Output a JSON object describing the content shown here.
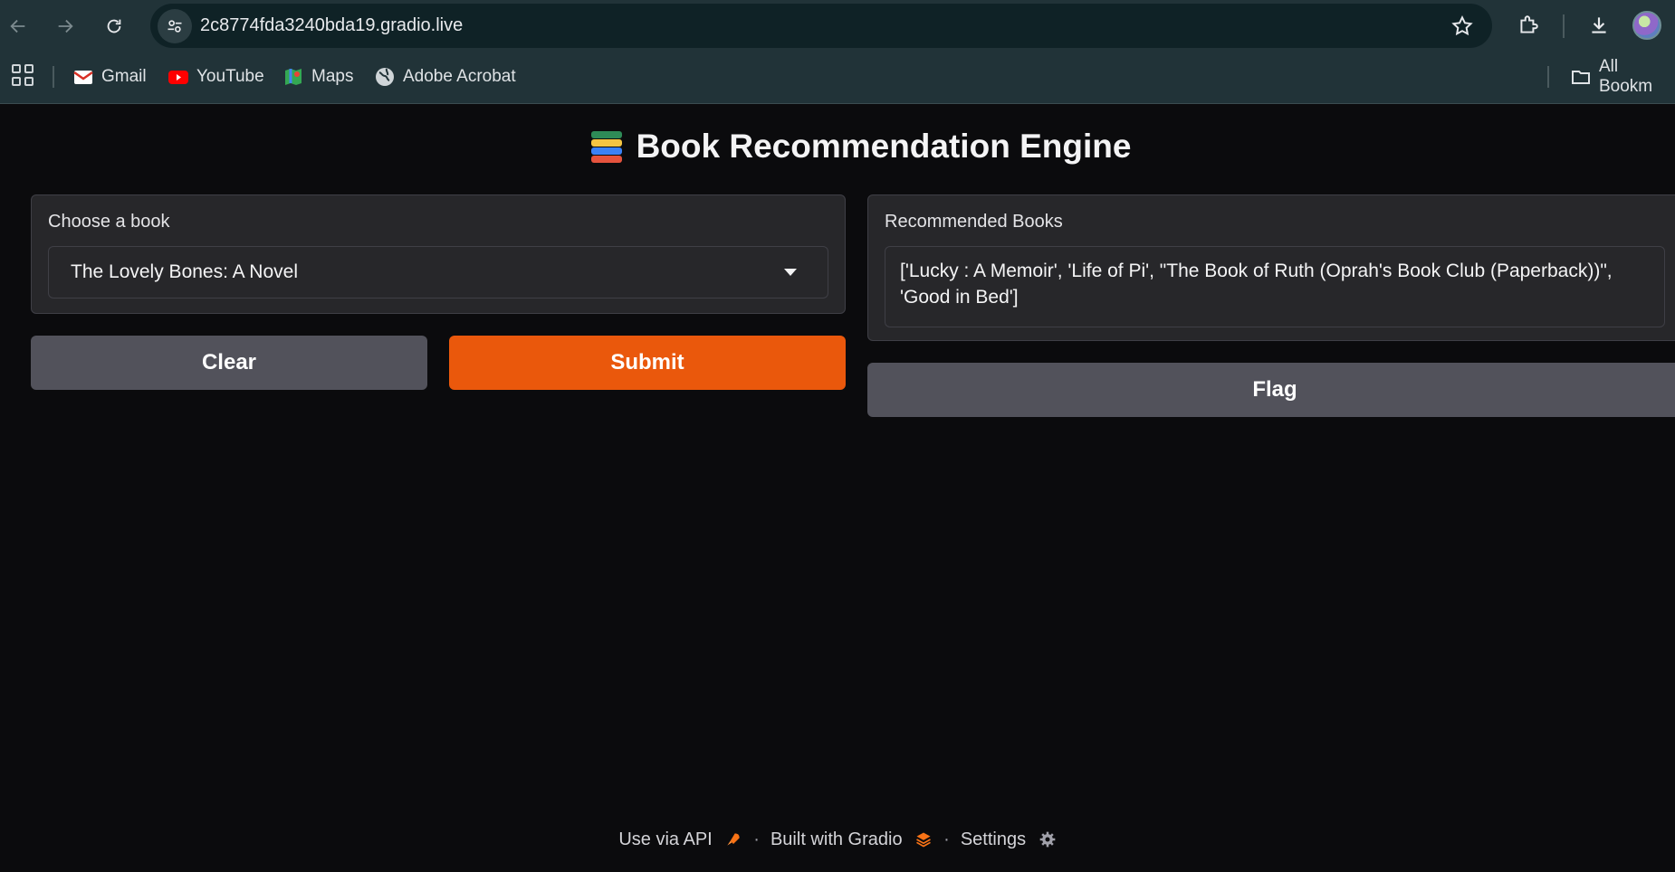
{
  "browser": {
    "url": "2c8774fda3240bda19.gradio.live",
    "bookmarks": [
      {
        "label": "Gmail",
        "icon": "gmail-icon"
      },
      {
        "label": "YouTube",
        "icon": "youtube-icon"
      },
      {
        "label": "Maps",
        "icon": "maps-icon"
      },
      {
        "label": "Adobe Acrobat",
        "icon": "globe-icon"
      }
    ],
    "all_bookmarks_label": "All Bookm"
  },
  "app": {
    "title": "Book Recommendation Engine",
    "title_icon": "books-icon",
    "input": {
      "label": "Choose a book",
      "selected": "The Lovely Bones: A Novel"
    },
    "output": {
      "label": "Recommended Books",
      "value": "['Lucky : A Memoir', 'Life of Pi', \"The Book of Ruth (Oprah's Book Club (Paperback))\", 'Good in Bed']"
    },
    "buttons": {
      "clear": "Clear",
      "submit": "Submit",
      "flag": "Flag"
    },
    "colors": {
      "primary": "#ea580c",
      "secondary": "#52525b",
      "background": "#0b0b0d",
      "panel": "#27272a"
    }
  },
  "footer": {
    "api": "Use via API",
    "built": "Built with Gradio",
    "settings": "Settings",
    "separator": "·"
  }
}
